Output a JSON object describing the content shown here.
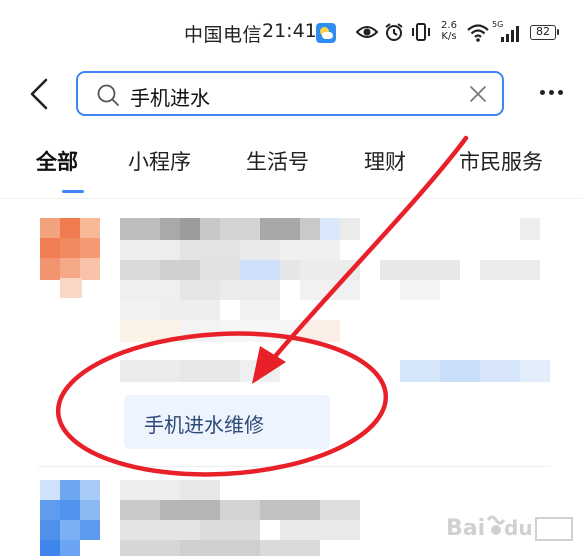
{
  "status_bar": {
    "carrier": "中国电信",
    "time": "21:41",
    "net_speed_value": "2.6",
    "net_speed_unit": "K/s",
    "signal_label": "5G",
    "battery": "82"
  },
  "search": {
    "value": "手机进水"
  },
  "tabs": [
    {
      "label": "全部",
      "active": true
    },
    {
      "label": "小程序",
      "active": false
    },
    {
      "label": "生活号",
      "active": false
    },
    {
      "label": "理财",
      "active": false
    },
    {
      "label": "市民服务",
      "active": false
    }
  ],
  "results": {
    "suggestion_chip": "手机进水维修"
  },
  "colors": {
    "accent": "#3e86f5",
    "annotation": "#e8202a",
    "chip_bg": "#eef4fd",
    "chip_text": "#2f4a78"
  },
  "icons": {
    "back": "chevron-left-icon",
    "search": "search-icon",
    "clear": "close-icon",
    "more": "more-dots-icon",
    "weather": "weather-icon",
    "eye": "eye-icon",
    "alarm": "alarm-icon",
    "vibrate": "vibrate-icon",
    "wifi": "wifi-icon",
    "signal": "signal-icon",
    "battery": "battery-icon"
  }
}
